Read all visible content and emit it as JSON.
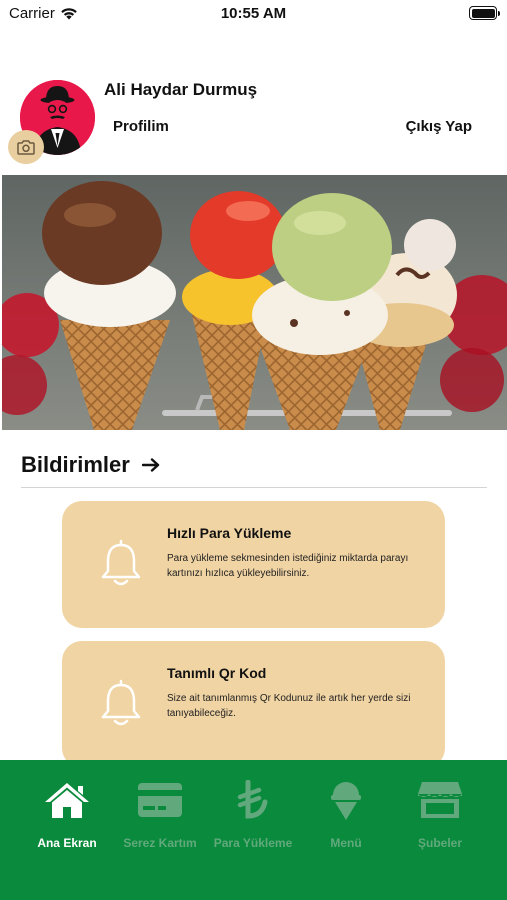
{
  "status_bar": {
    "carrier": "Carrier",
    "time": "10:55 AM"
  },
  "profile": {
    "name": "Ali Haydar Durmuş",
    "profile_label": "Profilim",
    "logout_label": "Çıkış Yap"
  },
  "notifications": {
    "title": "Bildirimler",
    "items": [
      {
        "title": "Hızlı Para Yükleme",
        "body": "Para yükleme sekmesinden istediğiniz miktarda parayı kartınızı hızlıca yükleyebilirsiniz."
      },
      {
        "title": "Tanımlı Qr Kod",
        "body": "Size ait tanımlanmış Qr Kodunuz ile artık her yerde sizi tanıyabileceğiz."
      }
    ]
  },
  "tabs": [
    {
      "label": "Ana Ekran",
      "icon": "home-icon",
      "active": true
    },
    {
      "label": "Serez Kartım",
      "icon": "card-icon",
      "active": false
    },
    {
      "label": "Para Yükleme",
      "icon": "lira-icon",
      "active": false
    },
    {
      "label": "Menü",
      "icon": "ice-cream-icon",
      "active": false
    },
    {
      "label": "Şubeler",
      "icon": "store-icon",
      "active": false
    }
  ],
  "colors": {
    "tab_bar": "#0a8a3c",
    "tab_inactive": "#61a97d",
    "card_bg": "#f1d4a4",
    "avatar_bg": "#e9184a"
  }
}
